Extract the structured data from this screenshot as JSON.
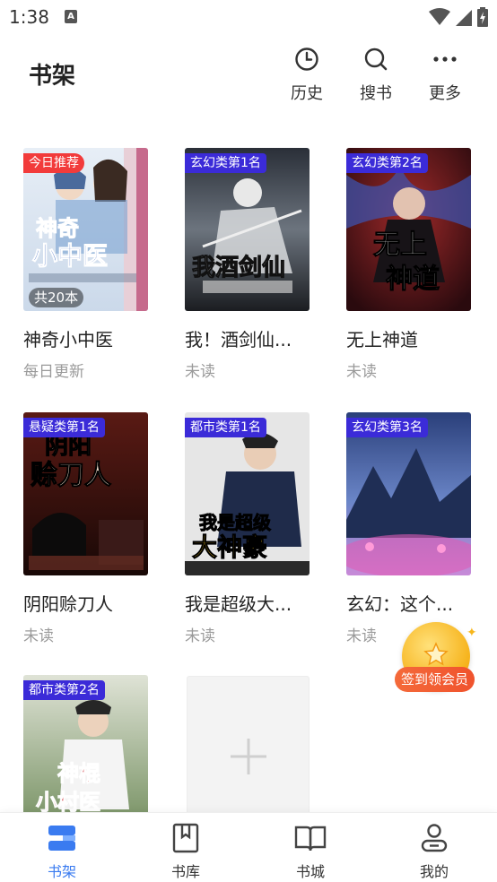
{
  "status_bar": {
    "time": "1:38",
    "notification_letter": "A"
  },
  "header": {
    "title": "书架",
    "actions": [
      {
        "label": "历史",
        "icon": "clock-icon"
      },
      {
        "label": "搜书",
        "icon": "search-icon"
      },
      {
        "label": "更多",
        "icon": "more-icon"
      }
    ]
  },
  "books": [
    {
      "title": "神奇小中医",
      "subtitle": "每日更新",
      "badge": "今日推荐",
      "count": "共20本",
      "cover_title": "神奇小中医"
    },
    {
      "title": "我！酒剑仙...",
      "subtitle": "未读",
      "badge": "玄幻类第1名",
      "cover_title": "我酒剑仙"
    },
    {
      "title": "无上神道",
      "subtitle": "未读",
      "badge": "玄幻类第2名",
      "cover_title": "无上神道"
    },
    {
      "title": "阴阳赊刀人",
      "subtitle": "未读",
      "badge": "悬疑类第1名",
      "cover_title": "阴阳赊刀人"
    },
    {
      "title": "我是超级大...",
      "subtitle": "未读",
      "badge": "都市类第1名",
      "cover_title": "我是超级大神豪"
    },
    {
      "title": "玄幻：这个...",
      "subtitle": "未读",
      "badge": "玄幻类第3名",
      "cover_title": ""
    },
    {
      "title": "",
      "subtitle": "",
      "badge": "都市类第2名",
      "cover_title": "神棍小村医"
    }
  ],
  "signin": {
    "label": "签到领会员"
  },
  "bottom_nav": [
    {
      "label": "书架",
      "icon": "bookshelf-icon",
      "active": true
    },
    {
      "label": "书库",
      "icon": "library-icon",
      "active": false
    },
    {
      "label": "书城",
      "icon": "bookstore-icon",
      "active": false
    },
    {
      "label": "我的",
      "icon": "profile-icon",
      "active": false
    }
  ],
  "colors": {
    "accent": "#3a7bf0",
    "rank_badge": "#3b2bd8",
    "recommend_badge": "#f23b3b",
    "signin_orange": "#f0532d"
  }
}
